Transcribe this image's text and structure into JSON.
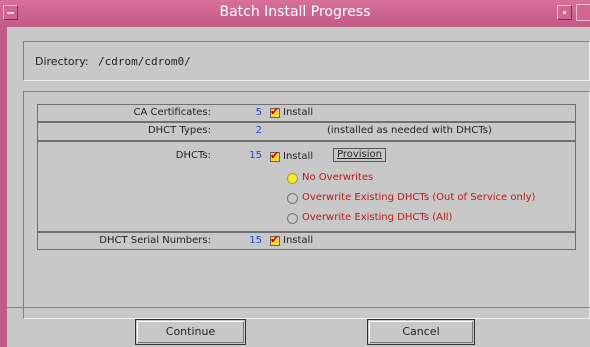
{
  "window": {
    "title": "Batch Install Progress"
  },
  "directory": {
    "label": "Directory:",
    "value": "/cdrom/cdrom0/"
  },
  "rows": {
    "ca_certificates": {
      "label": "CA Certificates:",
      "count": "5",
      "install_label": "Install",
      "install_checked": true
    },
    "dhct_types": {
      "label": "DHCT Types:",
      "count": "2",
      "note": "(installed as needed with DHCTs)"
    },
    "dhcts": {
      "label": "DHCTs:",
      "count": "15",
      "install_label": "Install",
      "install_checked": true,
      "provision_label": "Provision",
      "options": [
        {
          "label": "No Overwrites",
          "selected": true
        },
        {
          "label": "Overwrite Existing DHCTs (Out of Service only)",
          "selected": false
        },
        {
          "label": "Overwrite Existing DHCTs (All)",
          "selected": false
        }
      ]
    },
    "serial_numbers": {
      "label": "DHCT Serial Numbers:",
      "count": "15",
      "install_label": "Install",
      "install_checked": true
    }
  },
  "buttons": {
    "continue": "Continue",
    "cancel": "Cancel"
  },
  "colors": {
    "titlebar": "#c25a87",
    "count_blue": "#2e43d8",
    "option_red": "#c01818",
    "checkbox_yellow": "#f5d43a"
  }
}
